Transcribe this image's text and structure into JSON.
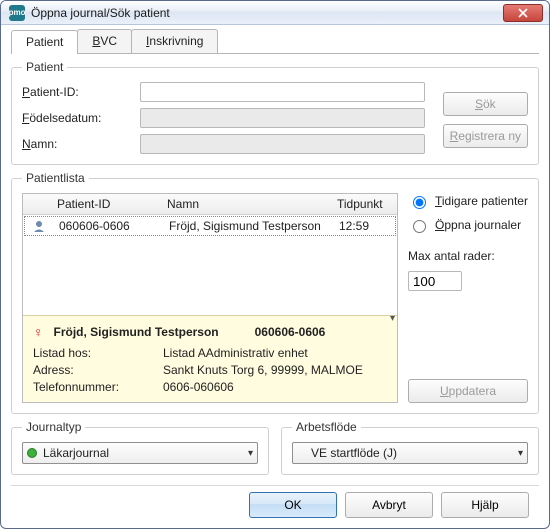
{
  "window": {
    "title": "Öppna journal/Sök patient",
    "app_icon_text": "pmo"
  },
  "tabs": {
    "patient": "Patient",
    "bvc": "BVC",
    "bvc_u": "B",
    "inskrivning": "Inskrivning",
    "inskrivning_u": "I"
  },
  "patient": {
    "legend": "Patient",
    "label_id": "Patient-ID:",
    "label_id_u": "P",
    "label_birth": "Födelsedatum:",
    "label_birth_u": "F",
    "label_name": "Namn:",
    "label_name_u": "N",
    "id_value": "",
    "birth_value": "",
    "name_value": ""
  },
  "buttons": {
    "search": "Sök",
    "search_u": "S",
    "register_new": "Registrera ny",
    "register_new_u": "R",
    "update": "Uppdatera",
    "update_u": "U",
    "ok": "OK",
    "cancel": "Avbryt",
    "help": "Hjälp"
  },
  "patientlista": {
    "legend": "Patientlista",
    "columns": {
      "id": "Patient-ID",
      "name": "Namn",
      "time": "Tidpunkt"
    },
    "rows": [
      {
        "id": "060606-0606",
        "name": "Fröjd, Sigismund Testperson",
        "time": "12:59"
      }
    ],
    "detail": {
      "gender_symbol": "♀",
      "name": "Fröjd, Sigismund Testperson",
      "pid": "060606-0606",
      "labels": {
        "listed": "Listad hos:",
        "address": "Adress:",
        "phone": "Telefonnummer:"
      },
      "listed": "Listad AAdministrativ enhet",
      "address": "Sankt Knuts Torg 6, 99999, MALMOE",
      "phone": "0606-060606"
    },
    "side": {
      "previous": "Tidigare patienter",
      "previous_u": "T",
      "open": "Öppna journaler",
      "open_u": "Ö",
      "max_rows_label": "Max antal rader:",
      "max_rows_value": "100"
    }
  },
  "journaltyp": {
    "legend": "Journaltyp",
    "selected": "Läkarjournal"
  },
  "arbetsflode": {
    "legend": "Arbetsflöde",
    "selected": "VE startflöde (J)"
  }
}
